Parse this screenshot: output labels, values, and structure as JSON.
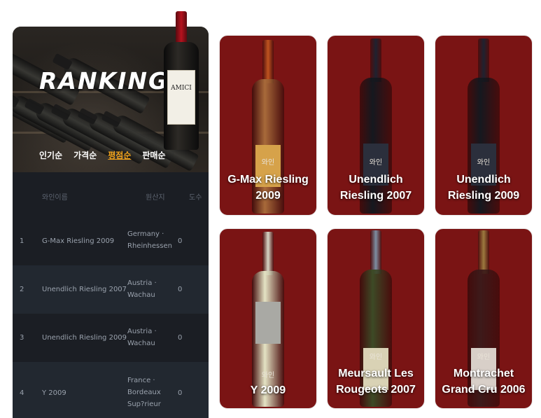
{
  "hero": {
    "title": "RANKING",
    "feature_bottle_label": "AMICI",
    "tabs": [
      {
        "label": "인기순",
        "active": false
      },
      {
        "label": "가격순",
        "active": false
      },
      {
        "label": "평점순",
        "active": true
      },
      {
        "label": "판매순",
        "active": false
      }
    ]
  },
  "table": {
    "headers": {
      "name": "와인이름",
      "region": "원산지",
      "abv": "도수"
    },
    "rows": [
      {
        "rank": "1",
        "name": "G-Max Riesling 2009",
        "region": "Germany · Rheinhessen",
        "abv": "0"
      },
      {
        "rank": "2",
        "name": "Unendlich Riesling 2007",
        "region": "Austria · Wachau",
        "abv": "0"
      },
      {
        "rank": "3",
        "name": "Unendlich Riesling 2009",
        "region": "Austria · Wachau",
        "abv": "0"
      },
      {
        "rank": "4",
        "name": "Y 2009",
        "region": "France · Bordeaux Sup?rieur",
        "abv": "0"
      }
    ]
  },
  "cards": [
    {
      "title": "G-Max Riesling 2009",
      "overlay": "와인",
      "neck_color": "#c0541f",
      "body_color": "#a86a3a",
      "label_color": "#d6a24a"
    },
    {
      "title": "Unendlich Riesling 2007",
      "overlay": "와인",
      "neck_color": "#1f2230",
      "body_color": "#15181f",
      "label_color": "#2b2f3c"
    },
    {
      "title": "Unendlich Riesling 2009",
      "overlay": "와인",
      "neck_color": "#1f2230",
      "body_color": "#15181f",
      "label_color": "#2b2f3c"
    },
    {
      "title": "Y 2009",
      "overlay": "와인",
      "neck_color": "#d9d8c7",
      "body_color": "#e4e3c4",
      "label_color": "#a9a9a4"
    },
    {
      "title": "Meursault Les Rougeots 2007",
      "overlay": "와인",
      "neck_color": "#7d8fa3",
      "body_color": "#3d4a26",
      "label_color": "#d9d2b5"
    },
    {
      "title": "Montrachet Grand Cru 2006",
      "overlay": "와인",
      "neck_color": "#9c7a3e",
      "body_color": "#3d1a1a",
      "label_color": "#d8cfc8"
    }
  ]
}
